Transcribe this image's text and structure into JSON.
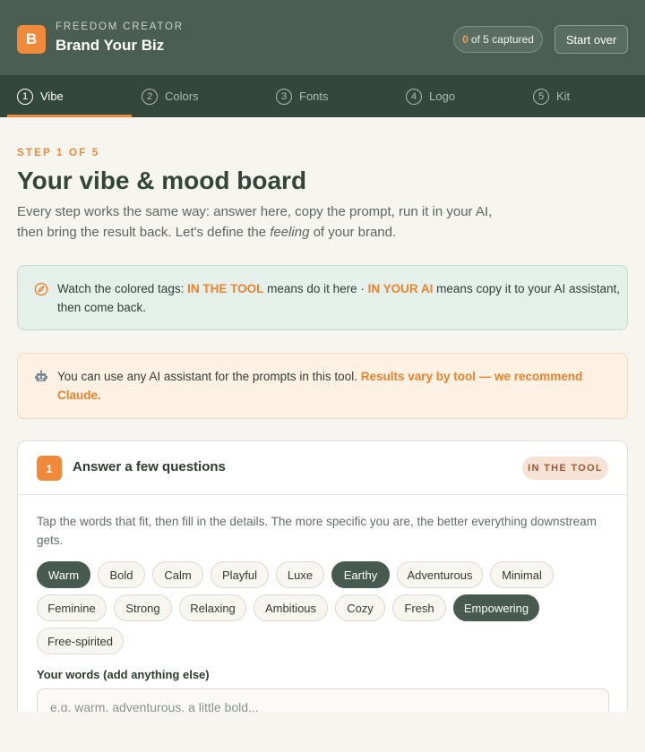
{
  "header": {
    "logo_letter": "B",
    "eyebrow": "FREEDOM CREATOR",
    "title": "Brand Your Biz",
    "captured_count": "0",
    "captured_suffix": "of 5 captured",
    "start_over_label": "Start over"
  },
  "tabs": [
    {
      "num": "1",
      "label": "Vibe",
      "active": true
    },
    {
      "num": "2",
      "label": "Colors",
      "active": false
    },
    {
      "num": "3",
      "label": "Fonts",
      "active": false
    },
    {
      "num": "4",
      "label": "Logo",
      "active": false
    },
    {
      "num": "5",
      "label": "Kit",
      "active": false
    }
  ],
  "intro": {
    "step_label": "STEP 1 OF 5",
    "title": "Your vibe & mood board",
    "text_before": "Every step works the same way: answer here, copy the prompt, run it in your AI, then bring the result back. Let's define the ",
    "text_em": "feeling",
    "text_after": " of your brand."
  },
  "callout_tags": {
    "icon": "compass-icon",
    "pre": "Watch the colored tags: ",
    "tag1": "IN THE TOOL",
    "mid": " means do it here · ",
    "tag2": "IN YOUR AI",
    "post": " means copy it to your AI assistant, then come back."
  },
  "callout_ai": {
    "icon": "robot-icon",
    "text": "You can use any AI assistant for the prompts in this tool. ",
    "highlight": "Results vary by tool — we recommend Claude."
  },
  "card": {
    "number": "1",
    "title": "Answer a few questions",
    "tag": "IN THE TOOL",
    "description": "Tap the words that fit, then fill in the details. The more specific you are, the better everything downstream gets.",
    "chips": [
      {
        "label": "Warm",
        "selected": true
      },
      {
        "label": "Bold",
        "selected": false
      },
      {
        "label": "Calm",
        "selected": false
      },
      {
        "label": "Playful",
        "selected": false
      },
      {
        "label": "Luxe",
        "selected": false
      },
      {
        "label": "Earthy",
        "selected": true
      },
      {
        "label": "Adventurous",
        "selected": false
      },
      {
        "label": "Minimal",
        "selected": false
      },
      {
        "label": "Feminine",
        "selected": false
      },
      {
        "label": "Strong",
        "selected": false
      },
      {
        "label": "Relaxing",
        "selected": false
      },
      {
        "label": "Ambitious",
        "selected": false
      },
      {
        "label": "Cozy",
        "selected": false
      },
      {
        "label": "Fresh",
        "selected": false
      },
      {
        "label": "Empowering",
        "selected": true
      },
      {
        "label": "Free-spirited",
        "selected": false
      }
    ],
    "words_label": "Your words (add anything else)",
    "words_value": "",
    "words_placeholder": "e.g. warm, adventurous, a little bold..."
  },
  "colors": {
    "header_bg": "#4a5e53",
    "tabs_bg": "#34473c",
    "accent": "#f08a3a",
    "chip_selected": "#475a4f"
  }
}
